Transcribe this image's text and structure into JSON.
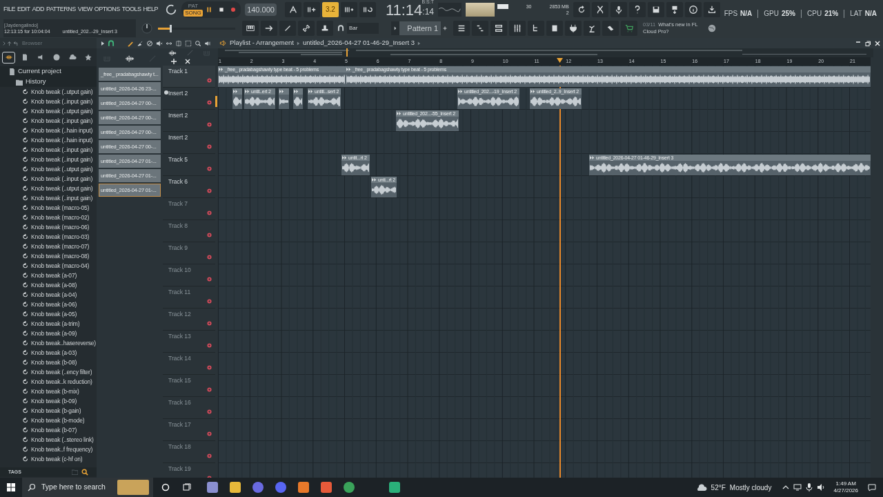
{
  "menu": [
    "FILE",
    "EDIT",
    "ADD",
    "PATTERNS",
    "VIEW",
    "OPTIONS",
    "TOOLS",
    "HELP"
  ],
  "hint_bar": {
    "user": "[Jaydengalindo]",
    "time": "12:13:15 for 10:04:04",
    "project": "untitled_202..-29_Insert 3"
  },
  "modes": [
    {
      "label": "PAT",
      "selected": false
    },
    {
      "label": "SONG",
      "selected": true
    }
  ],
  "tempo": "140.000",
  "countdown": {
    "label": "3.2",
    "on": true
  },
  "clock": {
    "main": "11:14",
    "seconds": ":14",
    "format": "B:S:T"
  },
  "master_pitch": {
    "level": 0.15
  },
  "monitor": {
    "cpu": "30",
    "memory": "2853 MB",
    "voices": "2"
  },
  "snap": "Bar",
  "pattern": "Pattern 1",
  "news": {
    "count": "03/11",
    "text": "What's new in FL Cloud Pro?"
  },
  "stats": [
    {
      "label": "FPS",
      "value": "N/A"
    },
    {
      "label": "GPU",
      "value": "25%"
    },
    {
      "label": "CPU",
      "value": "21%"
    },
    {
      "label": "LAT",
      "value": "N/A"
    }
  ],
  "browser": {
    "title": "Browser",
    "tabs": [
      {
        "selected": true
      },
      {
        "selected": false
      },
      {
        "selected": false
      },
      {
        "selected": false
      },
      {
        "selected": false
      },
      {
        "selected": false
      }
    ],
    "project": "Current project",
    "history": "History",
    "tags": "TAGS",
    "items": [
      "Knob tweak (..utput gain)",
      "Knob tweak (..input gain)",
      "Knob tweak (..utput gain)",
      "Knob tweak (..input gain)",
      "Knob tweak (..hain input)",
      "Knob tweak (..hain input)",
      "Knob tweak (..input gain)",
      "Knob tweak (..input gain)",
      "Knob tweak (..utput gain)",
      "Knob tweak (..input gain)",
      "Knob tweak (..utput gain)",
      "Knob tweak (..input gain)",
      "Knob tweak (macro-05)",
      "Knob tweak (macro-02)",
      "Knob tweak (macro-06)",
      "Knob tweak (macro-03)",
      "Knob tweak (macro-07)",
      "Knob tweak (macro-08)",
      "Knob tweak (macro-04)",
      "Knob tweak (a-07)",
      "Knob tweak (a-08)",
      "Knob tweak (a-04)",
      "Knob tweak (a-06)",
      "Knob tweak (a-05)",
      "Knob tweak (a-trim)",
      "Knob tweak (a-09)",
      "Knob tweak..hasereverse)",
      "Knob tweak (a-03)",
      "Knob tweak (b-08)",
      "Knob tweak (..ency filter)",
      "Knob tweak..k reduction)",
      "Knob tweak (b-mix)",
      "Knob tweak (b-09)",
      "Knob tweak (b-gain)",
      "Knob tweak (b-mode)",
      "Knob tweak (b-07)",
      "Knob tweak (..stereo link)",
      "Knob tweak..f frequency)",
      "Knob tweak (c-hf on)"
    ]
  },
  "clip_picker": [
    {
      "label": "_free_ pradabagshawty t...",
      "selected": false
    },
    {
      "label": "untitled_2026-04-26 23-...",
      "selected": false
    },
    {
      "label": "untitled_2026-04-27 00-...",
      "selected": false
    },
    {
      "label": "untitled_2026-04-27 00-...",
      "selected": false
    },
    {
      "label": "untitled_2026-04-27 00-...",
      "selected": false
    },
    {
      "label": "untitled_2026-04-27 00-...",
      "selected": false
    },
    {
      "label": "untitled_2026-04-27 01-...",
      "selected": false
    },
    {
      "label": "untitled_2026-04-27 01-...",
      "selected": false
    },
    {
      "label": "untitled_2026-04-27 01-...",
      "selected": true
    }
  ],
  "playlist": {
    "title": "Playlist - Arrangement",
    "pattern": "untitled_2026-04-27 01-46-29_Insert 3",
    "ruler": [
      "1",
      "2",
      "3",
      "4",
      "5",
      "6",
      "7",
      "8",
      "9",
      "10",
      "11",
      "12",
      "13",
      "14",
      "15",
      "16",
      "17",
      "18",
      "19",
      "20",
      "21"
    ],
    "tracks": [
      {
        "name": "Track 1",
        "empty": false,
        "clips": [
          {
            "kind": "audio",
            "label": "_free_ pradabagshawty type beat - 5 problems"
          },
          {
            "kind": "audio",
            "label": "_free_ pradabagshawty type beat - 5 problems"
          }
        ]
      },
      {
        "name": "Insert 2",
        "empty": false,
        "clips": [
          {
            "kind": "audio"
          },
          {
            "kind": "audio",
            "label": "untit..ert 2"
          },
          {
            "kind": "audio"
          },
          {
            "kind": "audio"
          },
          {
            "kind": "audio",
            "label": "untitl...sert 2"
          },
          {
            "kind": "audio",
            "label": "untitled_202...-19_Insert 2"
          },
          {
            "kind": "audio",
            "label": "untitled_2..9_Insert 2"
          }
        ]
      },
      {
        "name": "Insert 2",
        "empty": false,
        "clips": [
          {
            "kind": "audio",
            "label": "untitled_202...-55_Insert 2"
          }
        ]
      },
      {
        "name": "Insert 2",
        "empty": false
      },
      {
        "name": "Track 5",
        "empty": false,
        "clips": [
          {
            "kind": "audio",
            "label": "untit...rt 2"
          },
          {
            "kind": "audio",
            "label": "untitled_2026-04-27 01-46-29_Insert 3"
          }
        ]
      },
      {
        "name": "Track 6",
        "empty": false,
        "clips": [
          {
            "kind": "audio",
            "label": "unti...rt 2"
          }
        ]
      },
      {
        "name": "Track 7",
        "empty": true
      },
      {
        "name": "Track 8",
        "empty": true
      },
      {
        "name": "Track 9",
        "empty": true
      },
      {
        "name": "Track 10",
        "empty": true
      },
      {
        "name": "Track 11",
        "empty": true
      },
      {
        "name": "Track 12",
        "empty": true
      },
      {
        "name": "Track 13",
        "empty": true
      },
      {
        "name": "Track 14",
        "empty": true
      },
      {
        "name": "Track 15",
        "empty": true
      },
      {
        "name": "Track 16",
        "empty": true
      },
      {
        "name": "Track 17",
        "empty": true
      },
      {
        "name": "Track 18",
        "empty": true
      },
      {
        "name": "Track 19",
        "empty": true
      }
    ]
  },
  "taskbar": {
    "search_placeholder": "Type here to search",
    "temperature": "52°F",
    "condition": "Mostly cloudy",
    "time": "1:49 AM",
    "date": "4/27/2026"
  }
}
